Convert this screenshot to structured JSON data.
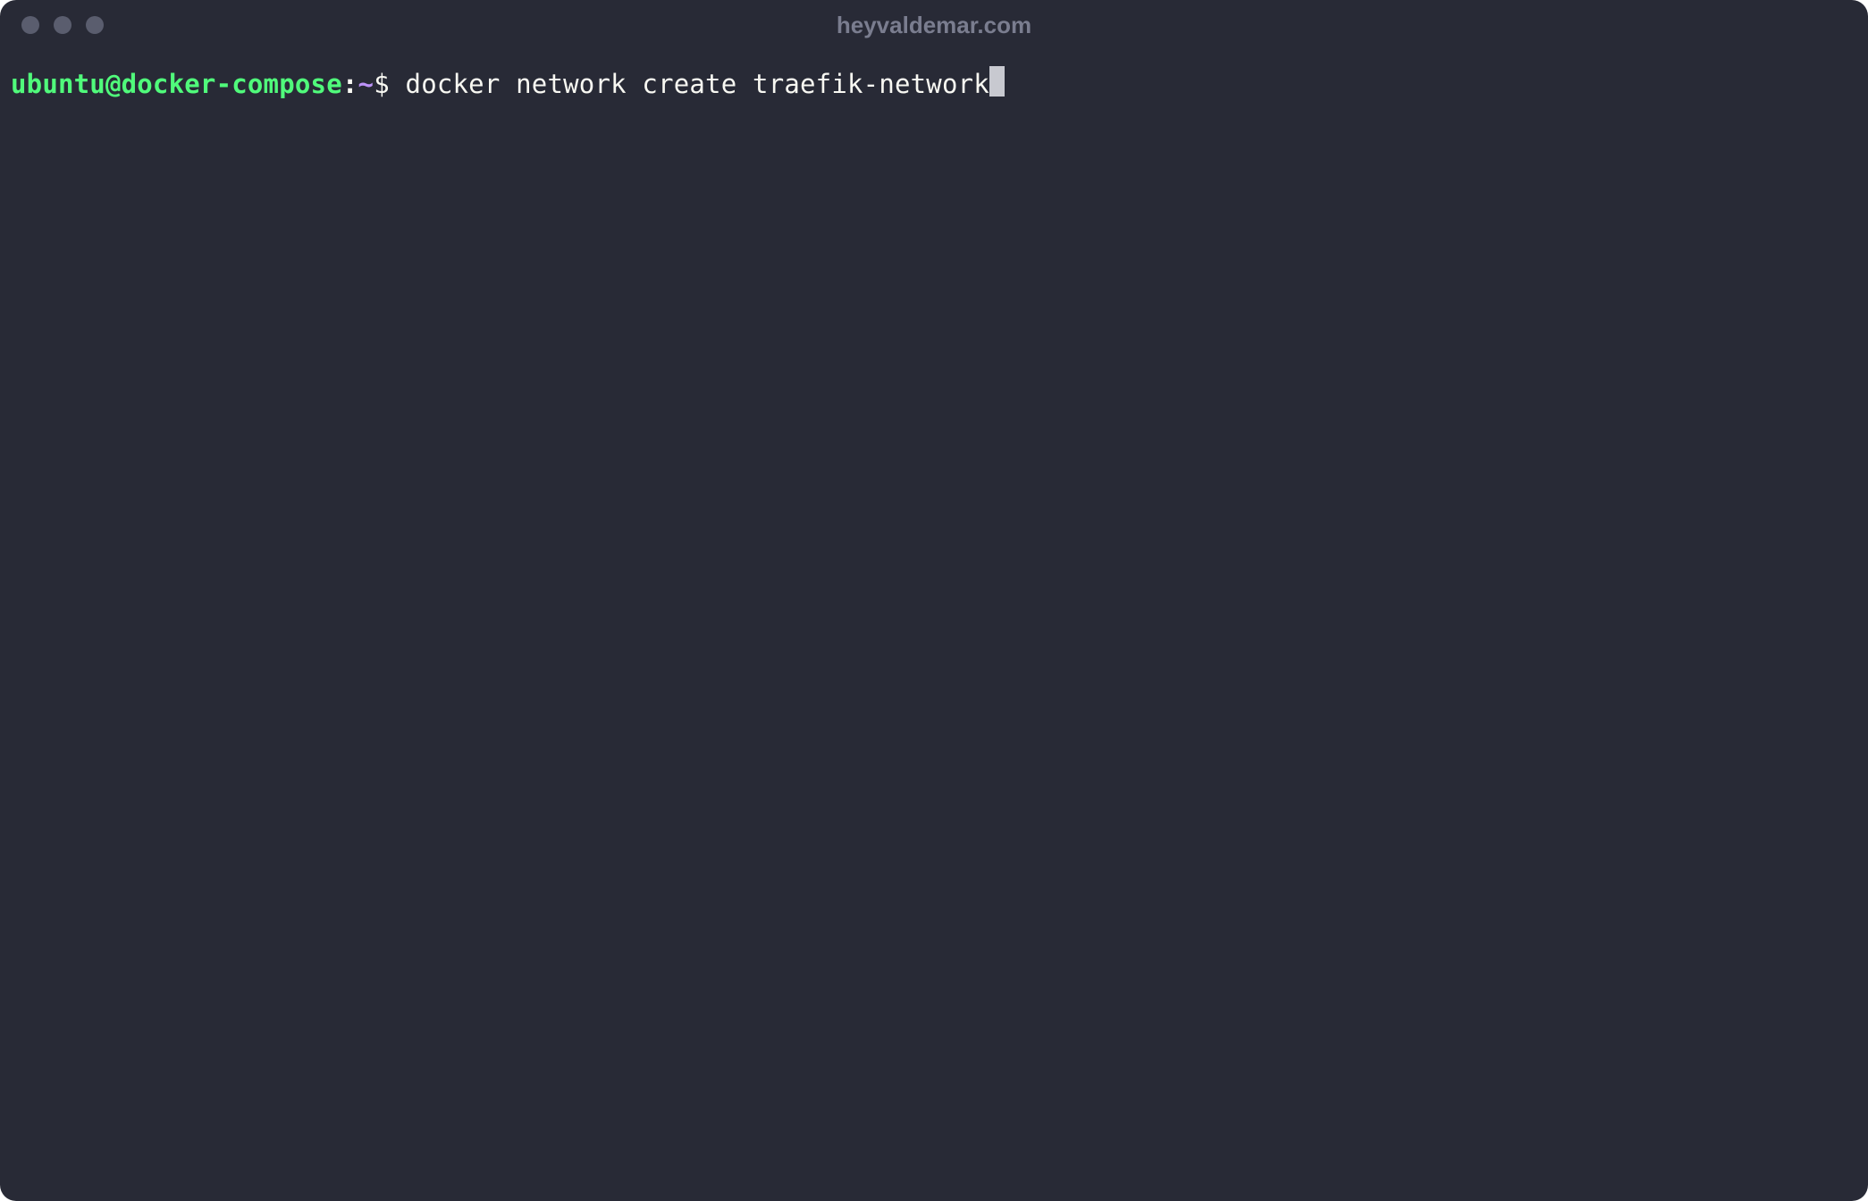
{
  "window": {
    "title": "heyvaldemar.com"
  },
  "terminal": {
    "prompt": {
      "user_host": "ubuntu@docker-compose",
      "colon": ":",
      "path": "~",
      "symbol": "$ "
    },
    "command": "docker network create traefik-network"
  },
  "colors": {
    "background": "#282a36",
    "prompt_user": "#50fa7b",
    "prompt_path": "#bd93f9",
    "text": "#f8f8f2",
    "title": "#7a7d8f",
    "control_button": "#5a5d6e",
    "cursor": "#c8c9d0"
  }
}
